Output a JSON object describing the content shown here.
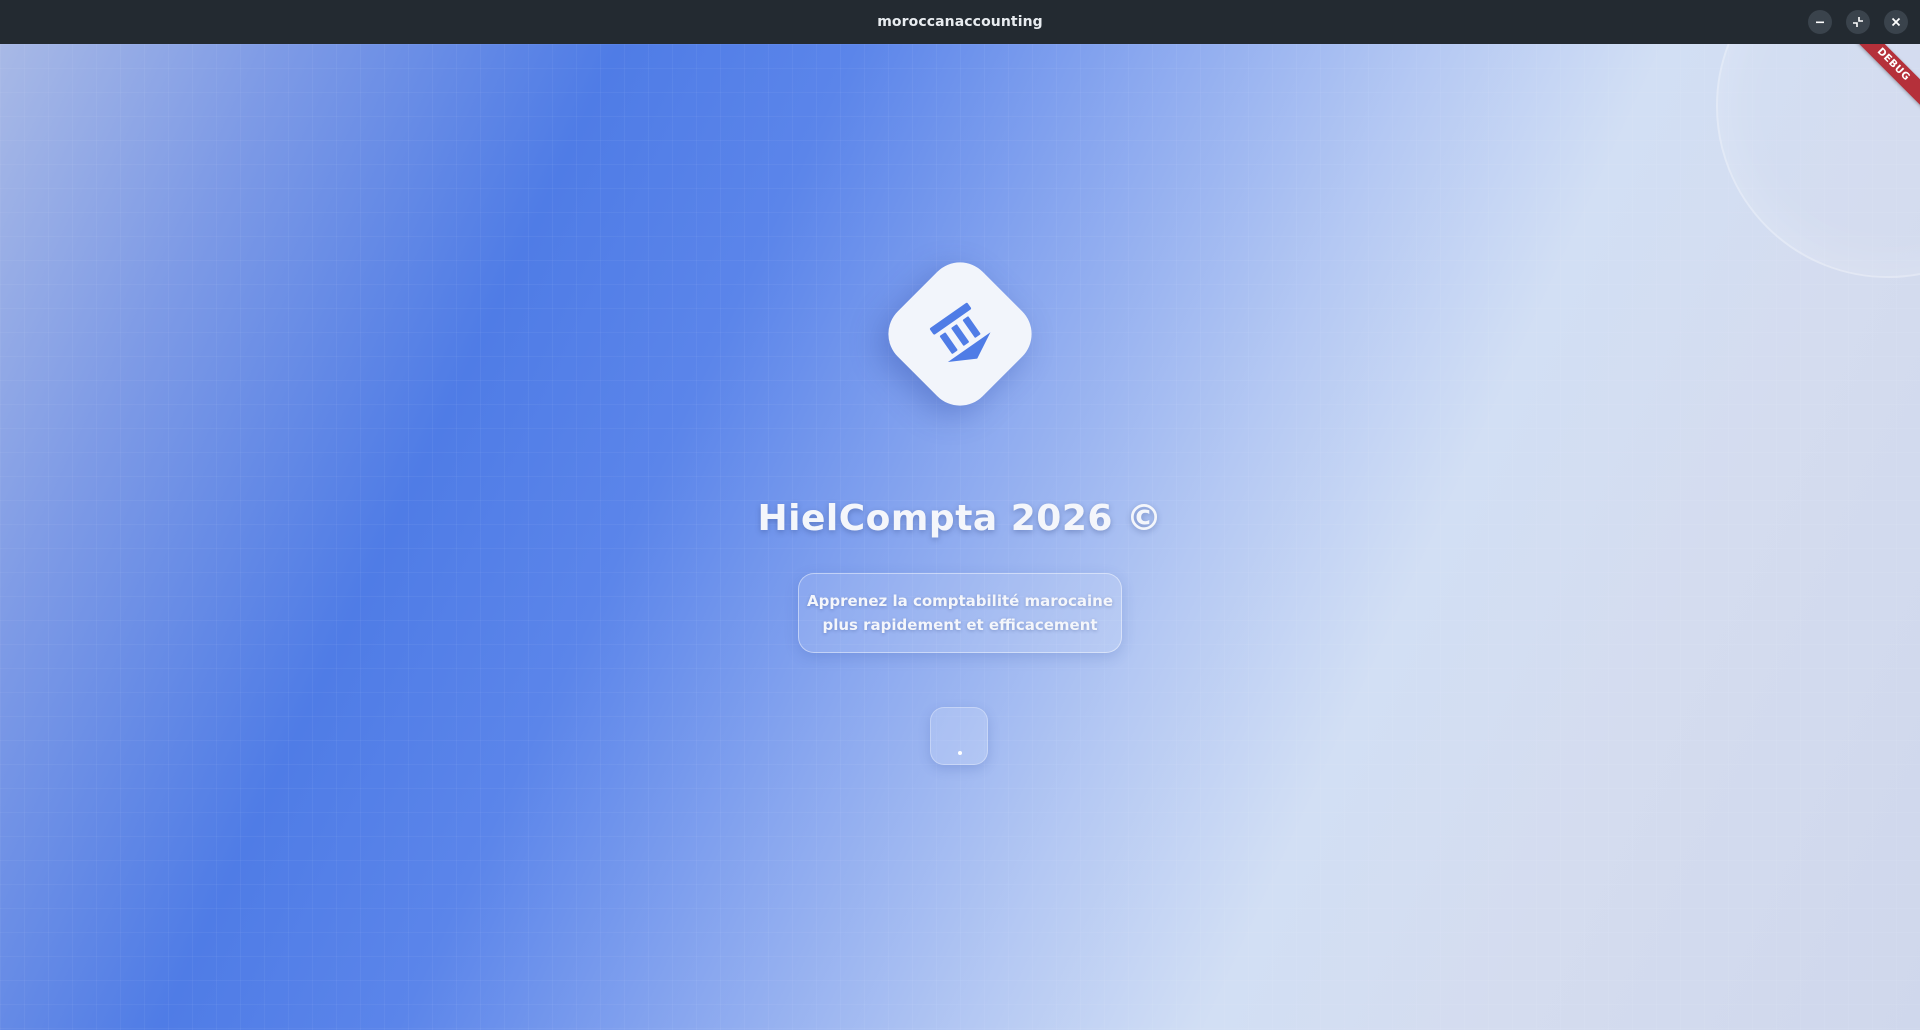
{
  "window": {
    "title": "moroccanaccounting",
    "controls": {
      "minimize_icon": "minimize-icon",
      "restore_icon": "restore-icon",
      "close_icon": "close-icon"
    }
  },
  "debug_banner": {
    "label": "DEBUG",
    "color": "#b5303a"
  },
  "splash": {
    "logo_icon": "columns-building-icon",
    "title": "HielCompta 2026 ©",
    "tagline_line1": "Apprenez la comptabilité marocaine",
    "tagline_line2": "plus rapidement et efficacement",
    "loader": "loading-indicator"
  },
  "colors": {
    "accent": "#4f7ce6",
    "titlebar": "#232a31",
    "logo_bg": "#f2f5fb",
    "logo_glyph": "#4f7ce6"
  }
}
